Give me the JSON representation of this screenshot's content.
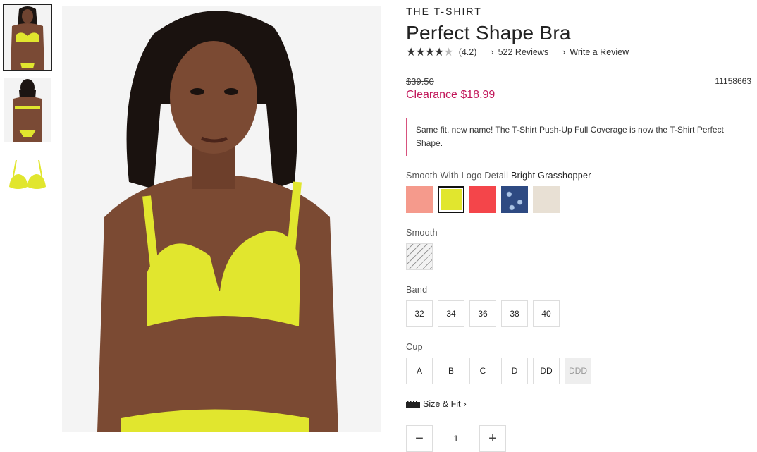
{
  "product": {
    "brand": "THE T-SHIRT",
    "title": "Perfect Shape Bra",
    "rating": "(4.2)",
    "stars": 4,
    "reviews_link": "522 Reviews",
    "write_review_link": "Write a Review",
    "original_price": "$39.50",
    "sale_price": "Clearance $18.99",
    "sku": "11158663",
    "notice": "Same fit, new name! The T-Shirt Push-Up Full Coverage is now the T-Shirt Perfect Shape."
  },
  "colors": {
    "group1_label": "Smooth With Logo Detail",
    "group1_selected": "Bright Grasshopper",
    "group1_swatches": [
      "#f59a8c",
      "#e1e62e",
      "#f4454a",
      "#2e4a82",
      "#e8e0d4"
    ],
    "group2_label": "Smooth",
    "group2_swatch": "#f2f2f2"
  },
  "band": {
    "label": "Band",
    "options": [
      "32",
      "34",
      "36",
      "38",
      "40"
    ]
  },
  "cup": {
    "label": "Cup",
    "options": [
      "A",
      "B",
      "C",
      "D",
      "DD",
      "DDD"
    ],
    "disabled": [
      "DDD"
    ]
  },
  "size_fit": "Size & Fit",
  "quantity": {
    "value": "1",
    "minus": "−",
    "plus": "+"
  },
  "accent": "#c2185b",
  "icons": [
    "star-icon",
    "chevron-right-icon",
    "ruler-icon"
  ]
}
